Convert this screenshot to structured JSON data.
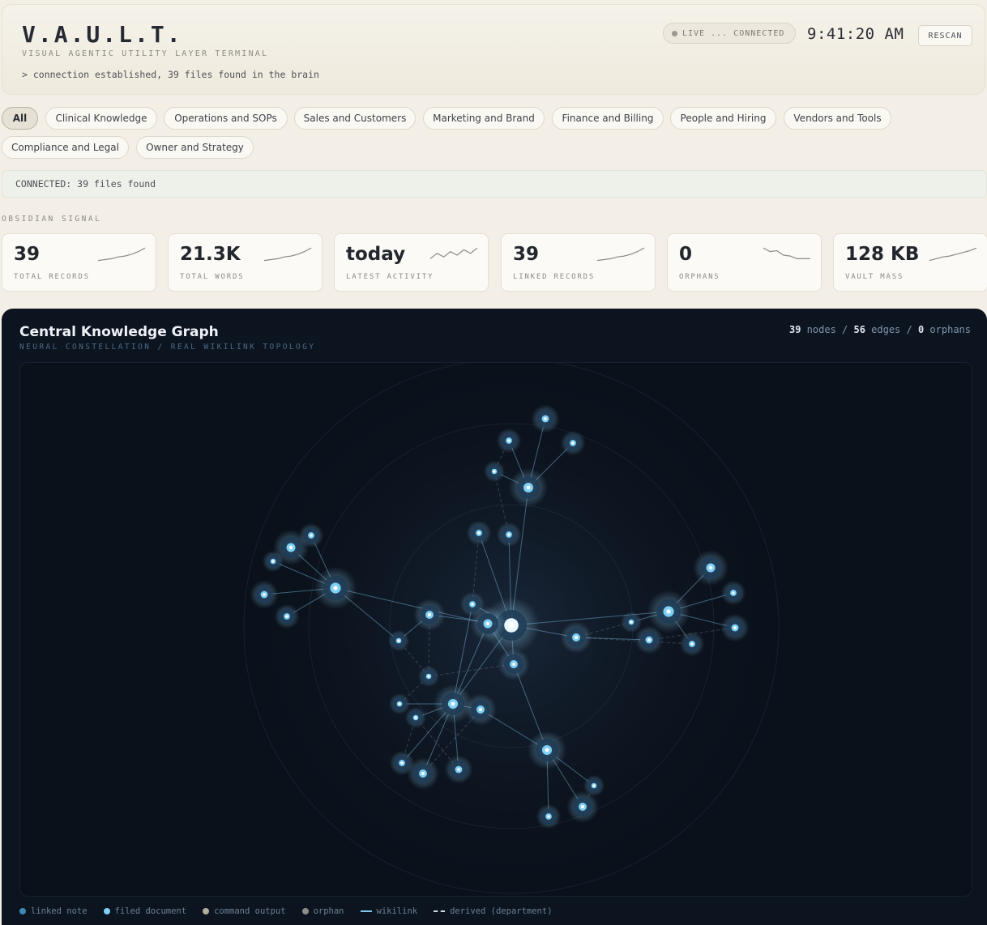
{
  "header": {
    "brand": "V.A.U.L.T.",
    "subtitle": "VISUAL AGENTIC UTILITY LAYER TERMINAL",
    "log": "> connection established, 39 files found in the brain",
    "live_status": "LIVE ... CONNECTED",
    "clock": "9:41:20 AM",
    "rescan_label": "RESCAN"
  },
  "filters": {
    "items": [
      {
        "label": "All",
        "active": true
      },
      {
        "label": "Clinical Knowledge"
      },
      {
        "label": "Operations and SOPs"
      },
      {
        "label": "Sales and Customers"
      },
      {
        "label": "Marketing and Brand"
      },
      {
        "label": "Finance and Billing"
      },
      {
        "label": "People and Hiring"
      },
      {
        "label": "Vendors and Tools"
      },
      {
        "label": "Compliance and Legal"
      },
      {
        "label": "Owner and Strategy"
      }
    ]
  },
  "status": {
    "text": "CONNECTED: 39 files found"
  },
  "signal": {
    "section_label": "OBSIDIAN SIGNAL",
    "cards": [
      {
        "value": "39",
        "label": "TOTAL RECORDS",
        "trend": [
          0.2,
          0.25,
          0.3,
          0.4,
          0.45,
          0.55,
          0.7,
          0.9
        ]
      },
      {
        "value": "21.3K",
        "label": "TOTAL WORDS",
        "trend": [
          0.2,
          0.25,
          0.3,
          0.4,
          0.45,
          0.55,
          0.7,
          0.9
        ]
      },
      {
        "value": "today",
        "label": "LATEST ACTIVITY",
        "trend": [
          0.3,
          0.6,
          0.4,
          0.7,
          0.5,
          0.8,
          0.6,
          0.9
        ]
      },
      {
        "value": "39",
        "label": "LINKED RECORDS",
        "trend": [
          0.2,
          0.25,
          0.3,
          0.4,
          0.45,
          0.55,
          0.7,
          0.9
        ]
      },
      {
        "value": "0",
        "label": "ORPHANS",
        "trend": [
          0.9,
          0.7,
          0.75,
          0.5,
          0.45,
          0.3,
          0.3,
          0.3
        ]
      },
      {
        "value": "128 KB",
        "label": "VAULT MASS",
        "trend": [
          0.2,
          0.3,
          0.4,
          0.45,
          0.55,
          0.65,
          0.75,
          0.9
        ]
      }
    ]
  },
  "graph": {
    "title": "Central Knowledge Graph",
    "subtitle": "NEURAL CONSTELLATION / REAL WIKILINK TOPOLOGY",
    "nodes_count": "39",
    "nodes_text": " nodes / ",
    "edges_count": "56",
    "edges_text": " edges / ",
    "orphans_count": "0",
    "orphans_text": " orphans",
    "colors": {
      "linked_note": "#3f88b6",
      "filed_document": "#7fd0f5",
      "command_output": "#b3ada0",
      "orphan": "#8e8e88",
      "wikilink": "#7fc4ea",
      "derived": "#c8d6e2"
    },
    "legend": [
      {
        "label": "linked note",
        "kind": "dot",
        "color": "#3f88b6"
      },
      {
        "label": "filed document",
        "kind": "dot",
        "color": "#7fd0f5"
      },
      {
        "label": "command output",
        "kind": "dot",
        "color": "#b3ada0"
      },
      {
        "label": "orphan",
        "kind": "dot",
        "color": "#8e8e88"
      },
      {
        "label": "wikilink",
        "kind": "line",
        "color": "#7fc4ea"
      },
      {
        "label": "derived (department)",
        "kind": "dash",
        "color": "#c8d6e2"
      }
    ]
  }
}
